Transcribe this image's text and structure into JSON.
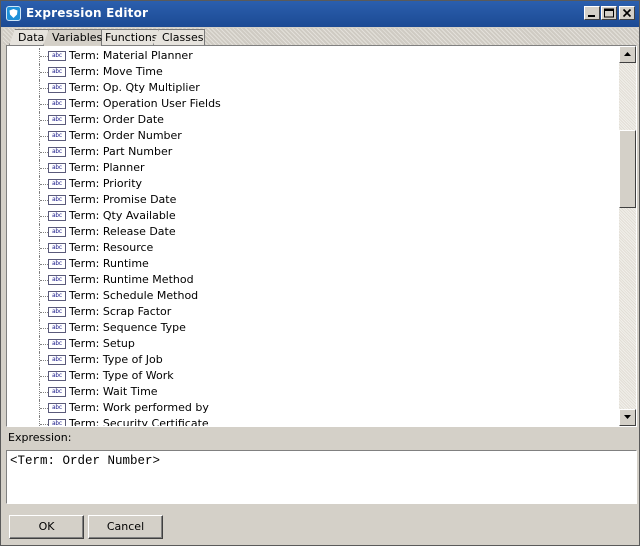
{
  "window": {
    "title": "Expression Editor"
  },
  "tabs": [
    {
      "label": "Data"
    },
    {
      "label": "Variables"
    },
    {
      "label": "Functions"
    },
    {
      "label": "Classes"
    }
  ],
  "active_tab": "Variables",
  "tree": {
    "icon_text": "abc",
    "items": [
      "Term: Material Planner",
      "Term: Move Time",
      "Term: Op. Qty Multiplier",
      "Term: Operation User Fields",
      "Term: Order Date",
      "Term: Order Number",
      "Term: Part Number",
      "Term: Planner",
      "Term: Priority",
      "Term: Promise Date",
      "Term: Qty Available",
      "Term: Release Date",
      "Term: Resource",
      "Term: Runtime",
      "Term: Runtime Method",
      "Term: Schedule Method",
      "Term: Scrap Factor",
      "Term: Sequence Type",
      "Term: Setup",
      "Term: Type of Job",
      "Term: Type of Work",
      "Term: Wait Time",
      "Term: Work performed by",
      "Term: Security Certificate"
    ]
  },
  "expression": {
    "label": "Expression:",
    "value": "<Term: Order Number>"
  },
  "buttons": {
    "ok": "OK",
    "cancel": "Cancel"
  }
}
